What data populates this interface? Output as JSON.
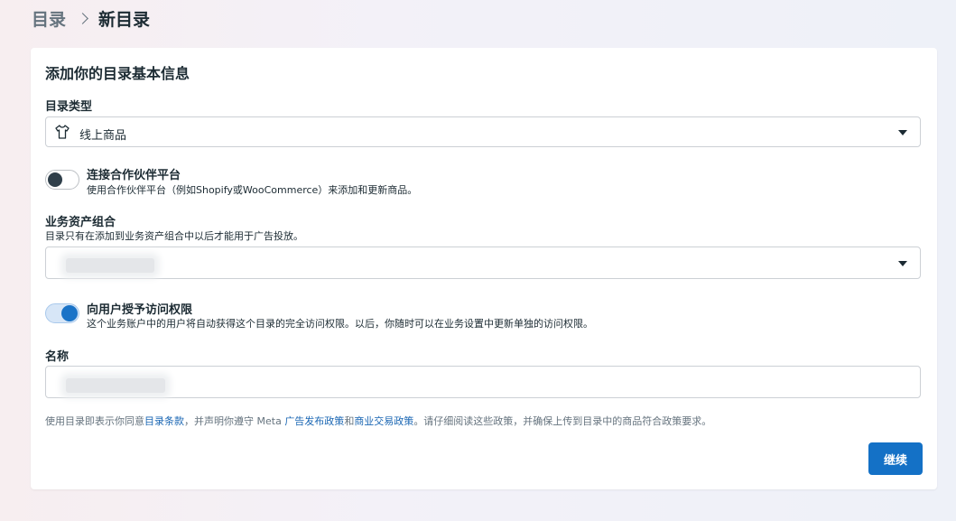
{
  "breadcrumb": {
    "root": "目录",
    "current": "新目录"
  },
  "card": {
    "title": "添加你的目录基本信息",
    "catalog_type": {
      "label": "目录类型",
      "value": "线上商品",
      "icon": "tshirt-icon"
    },
    "partner_platform": {
      "title": "连接合作伙伴平台",
      "description": "使用合作伙伴平台（例如Shopify或WooCommerce）来添加和更新商品。",
      "enabled": false
    },
    "business_portfolio": {
      "label": "业务资产组合",
      "description": "目录只有在添加到业务资产组合中以后才能用于广告投放。",
      "value_redacted": true
    },
    "grant_access": {
      "title": "向用户授予访问权限",
      "description": "这个业务账户中的用户将自动获得这个目录的完全访问权限。以后，你随时可以在业务设置中更新单独的访问权限。",
      "enabled": true
    },
    "name": {
      "label": "名称",
      "value_redacted": true
    },
    "terms": {
      "prefix": "使用目录即表示你同意",
      "link1": "目录条款",
      "middle": "，并声明你遵守 Meta ",
      "link2": "广告发布政策",
      "and": "和",
      "link3": "商业交易政策",
      "suffix": "。请仔细阅读这些政策，并确保上传到目录中的商品符合政策要求。"
    },
    "continue_label": "继续"
  },
  "colors": {
    "primary": "#1471c6",
    "link": "#1a66b3",
    "text": "#1c2b33",
    "muted": "#65737e",
    "toggle_on": "#1a73c7"
  }
}
